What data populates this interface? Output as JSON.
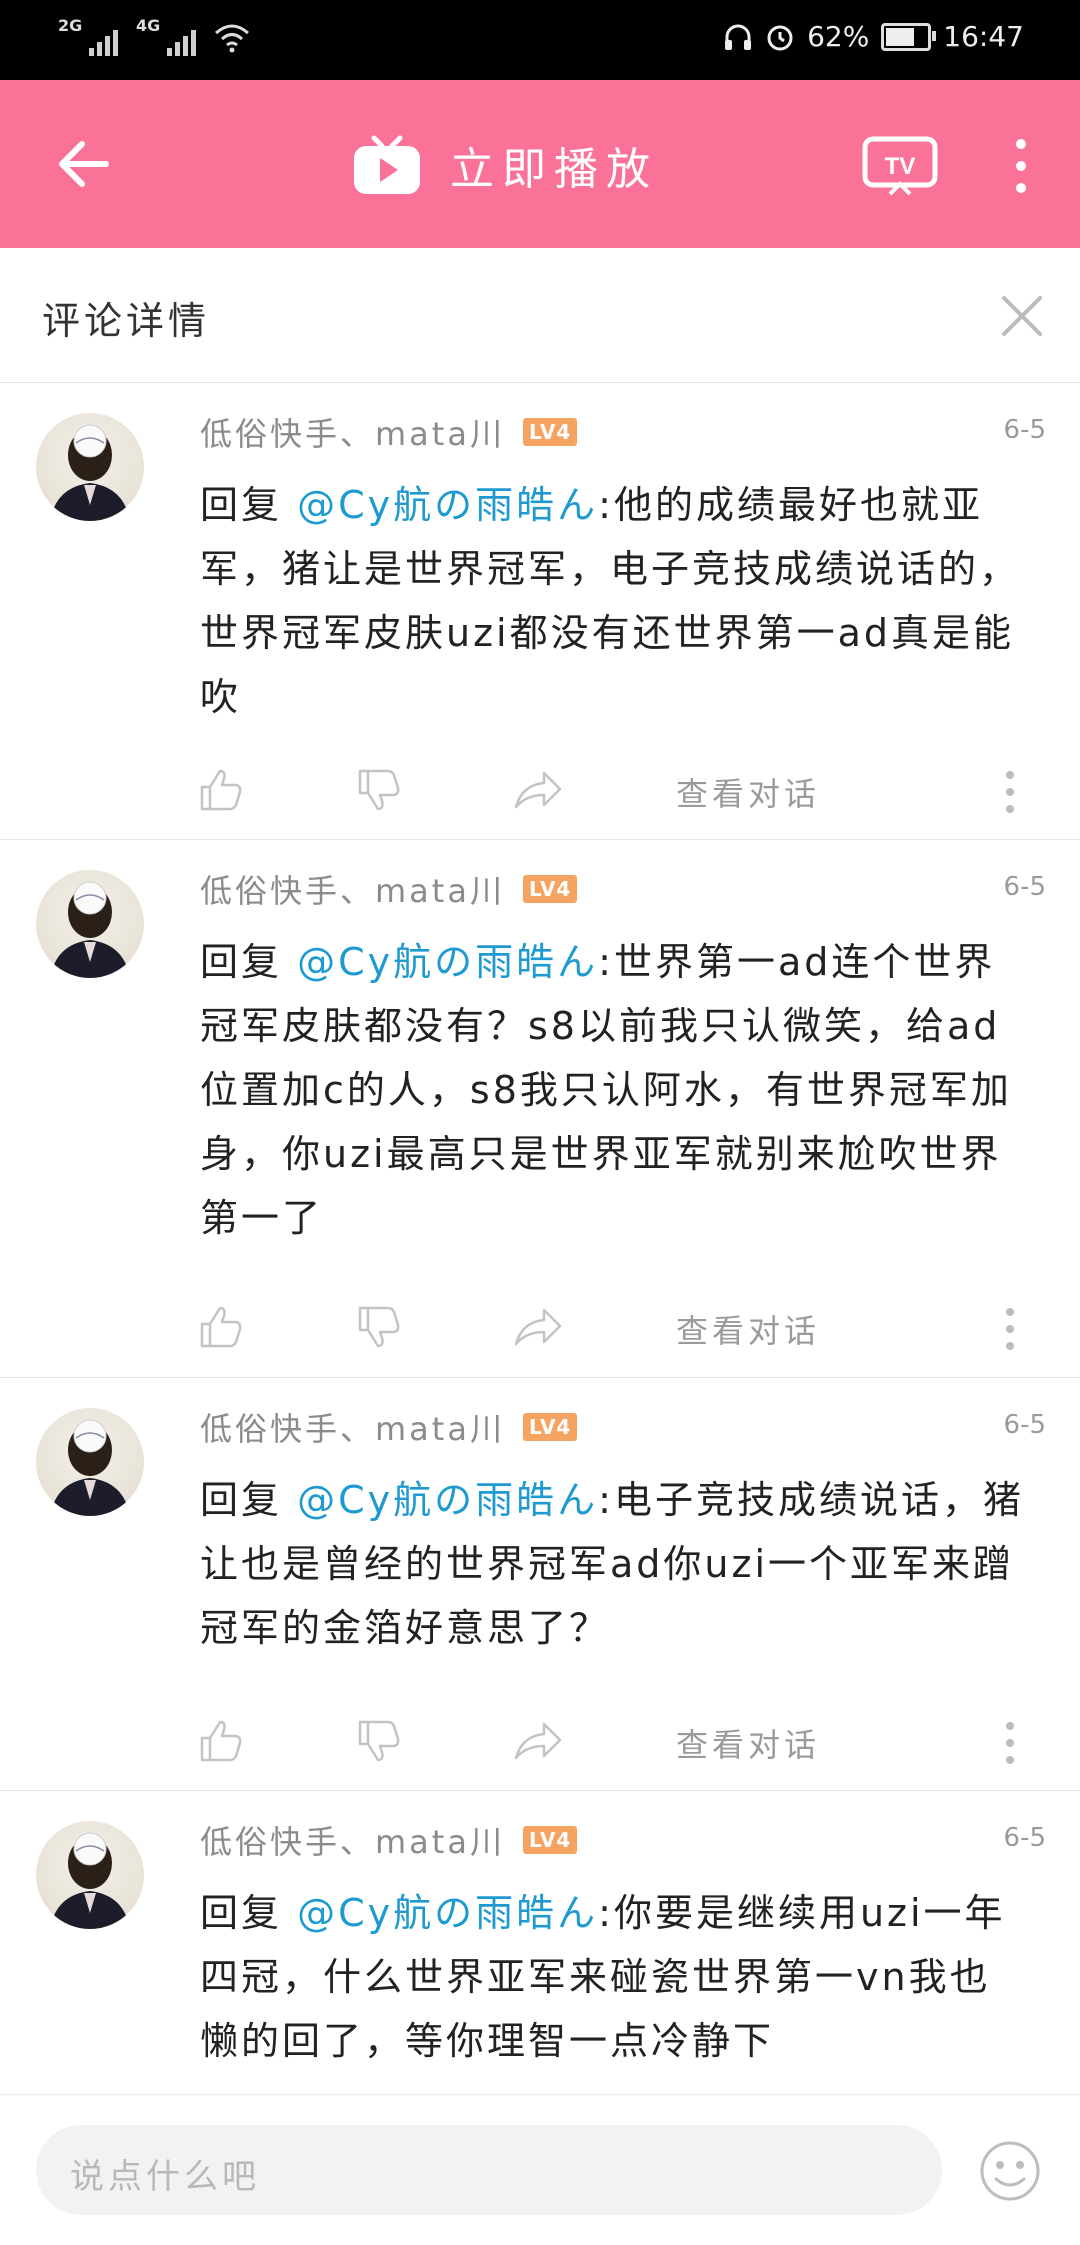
{
  "status_bar": {
    "signal1": "2G",
    "signal2": "4G",
    "battery": "62%",
    "time": "16:47"
  },
  "app_bar": {
    "title": "立即播放",
    "brand_color": "#fb7299",
    "icons": [
      "back-arrow-icon",
      "tv-logo-icon",
      "cast-tv-icon",
      "more-vert-icon"
    ]
  },
  "panel": {
    "title": "评论详情"
  },
  "comments": [
    {
      "user": "低俗快手、mata川",
      "level": "LV4",
      "date": "6-5",
      "reply_prefix": "回复",
      "mention": "@Cy航の雨皓ん",
      "text": ":他的成绩最好也就亚军，猪让是世界冠军，电子竞技成绩说话的，世界冠军皮肤uzi都没有还世界第一ad真是能吹",
      "view_conversation": "查看对话"
    },
    {
      "user": "低俗快手、mata川",
      "level": "LV4",
      "date": "6-5",
      "reply_prefix": "回复",
      "mention": "@Cy航の雨皓ん",
      "text": ":世界第一ad连个世界冠军皮肤都没有？s8以前我只认微笑，给ad位置加c的人，s8我只认阿水，有世界冠军加身，你uzi最高只是世界亚军就别来尬吹世界第一了",
      "view_conversation": "查看对话"
    },
    {
      "user": "低俗快手、mata川",
      "level": "LV4",
      "date": "6-5",
      "reply_prefix": "回复",
      "mention": "@Cy航の雨皓ん",
      "text": ":电子竞技成绩说话，猪让也是曾经的世界冠军ad你uzi一个亚军来蹭冠军的金箔好意思了？",
      "view_conversation": "查看对话"
    },
    {
      "user": "低俗快手、mata川",
      "level": "LV4",
      "date": "6-5",
      "reply_prefix": "回复",
      "mention": "@Cy航の雨皓ん",
      "text": ":你要是继续用uzi一年四冠，什么世界亚军来碰瓷世界第一vn我也懒的回了，等你理智一点冷静下",
      "view_conversation": "查看对话"
    }
  ],
  "input": {
    "placeholder": "说点什么吧"
  }
}
